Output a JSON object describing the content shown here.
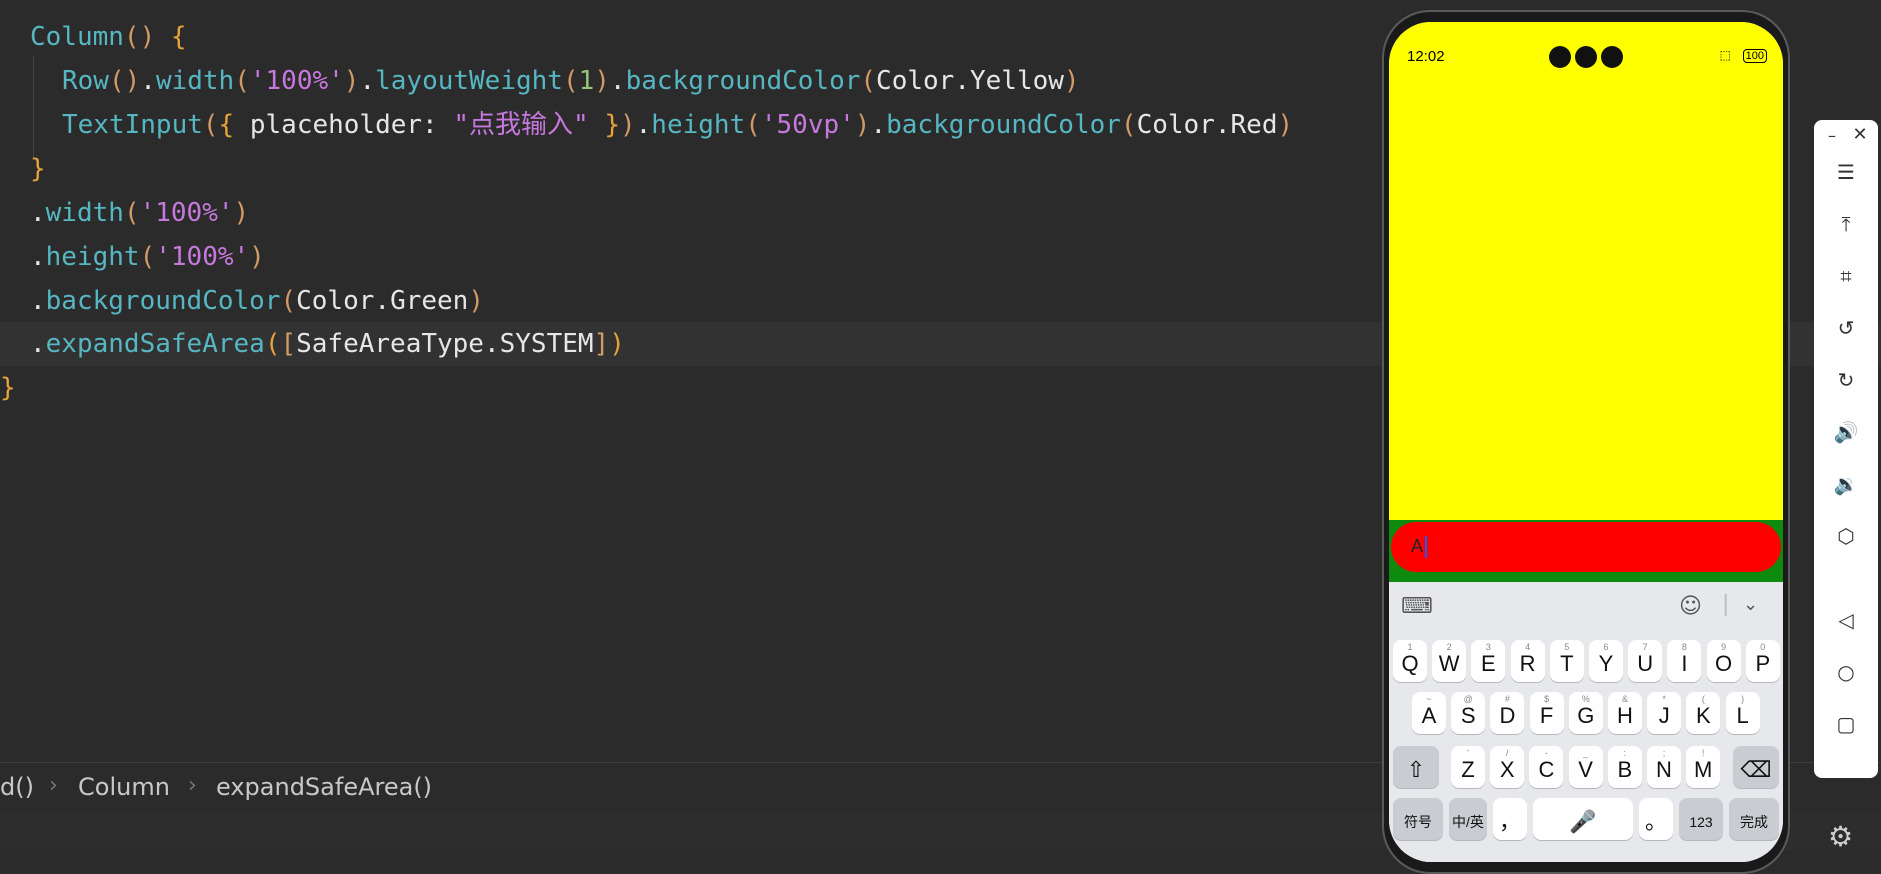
{
  "editor": {
    "lines": [
      {
        "indent": 1,
        "tokens": [
          [
            "fn",
            "Column"
          ],
          [
            "paren",
            "() "
          ],
          [
            "brace",
            "{"
          ]
        ]
      },
      {
        "indent": 2,
        "tokens": [
          [
            "fn",
            "Row"
          ],
          [
            "paren",
            "()"
          ],
          [
            "dot",
            "."
          ],
          [
            "fn",
            "width"
          ],
          [
            "paren",
            "("
          ],
          [
            "str",
            "'100%'"
          ],
          [
            "paren",
            ")"
          ],
          [
            "dot",
            "."
          ],
          [
            "fn",
            "layoutWeight"
          ],
          [
            "paren",
            "("
          ],
          [
            "num",
            "1"
          ],
          [
            "paren",
            ")"
          ],
          [
            "dot",
            "."
          ],
          [
            "fn",
            "backgroundColor"
          ],
          [
            "paren",
            "("
          ],
          [
            "plain",
            "Color"
          ],
          [
            "dot",
            "."
          ],
          [
            "plain",
            "Yellow"
          ],
          [
            "paren",
            ")"
          ]
        ]
      },
      {
        "indent": 2,
        "tokens": [
          [
            "fn",
            "TextInput"
          ],
          [
            "paren",
            "("
          ],
          [
            "brace",
            "{ "
          ],
          [
            "plain",
            "placeholder: "
          ],
          [
            "str",
            "\"点我输入\""
          ],
          [
            "brace",
            " }"
          ],
          [
            "paren",
            ")"
          ],
          [
            "dot",
            "."
          ],
          [
            "fn",
            "height"
          ],
          [
            "paren",
            "("
          ],
          [
            "str",
            "'50vp'"
          ],
          [
            "paren",
            ")"
          ],
          [
            "dot",
            "."
          ],
          [
            "fn",
            "backgroundColor"
          ],
          [
            "paren",
            "("
          ],
          [
            "plain",
            "Color"
          ],
          [
            "dot",
            "."
          ],
          [
            "plain",
            "Red"
          ],
          [
            "paren",
            ")"
          ]
        ]
      },
      {
        "indent": 1,
        "tokens": [
          [
            "brace",
            "}"
          ]
        ]
      },
      {
        "indent": 1,
        "tokens": [
          [
            "dot",
            "."
          ],
          [
            "fn",
            "width"
          ],
          [
            "paren",
            "("
          ],
          [
            "str",
            "'100%'"
          ],
          [
            "paren",
            ")"
          ]
        ]
      },
      {
        "indent": 1,
        "tokens": [
          [
            "dot",
            "."
          ],
          [
            "fn",
            "height"
          ],
          [
            "paren",
            "("
          ],
          [
            "str",
            "'100%'"
          ],
          [
            "paren",
            ")"
          ]
        ]
      },
      {
        "indent": 1,
        "tokens": [
          [
            "dot",
            "."
          ],
          [
            "fn",
            "backgroundColor"
          ],
          [
            "paren",
            "("
          ],
          [
            "plain",
            "Color"
          ],
          [
            "dot",
            "."
          ],
          [
            "plain",
            "Green"
          ],
          [
            "paren",
            ")"
          ]
        ]
      },
      {
        "indent": 1,
        "tokens": [
          [
            "dot",
            "."
          ],
          [
            "fn",
            "expandSafeArea"
          ],
          [
            "brace",
            "("
          ],
          [
            "paren",
            "["
          ],
          [
            "plain",
            "SafeAreaType"
          ],
          [
            "dot",
            "."
          ],
          [
            "plain",
            "SYSTEM"
          ],
          [
            "paren",
            "]"
          ],
          [
            "brace",
            ")"
          ]
        ]
      },
      {
        "indent": 0,
        "tokens": [
          [
            "brace",
            "}"
          ]
        ]
      }
    ]
  },
  "breadcrumb": {
    "items": [
      "d()",
      "Column",
      "expandSafeArea()"
    ],
    "separator": "›"
  },
  "phone": {
    "time": "12:02",
    "battery": "100",
    "input_value": "A",
    "keyboard": {
      "row1": [
        [
          "1",
          "Q"
        ],
        [
          "2",
          "W"
        ],
        [
          "3",
          "E"
        ],
        [
          "4",
          "R"
        ],
        [
          "5",
          "T"
        ],
        [
          "6",
          "Y"
        ],
        [
          "7",
          "U"
        ],
        [
          "8",
          "I"
        ],
        [
          "9",
          "O"
        ],
        [
          "0",
          "P"
        ]
      ],
      "row2": [
        [
          "~",
          "A"
        ],
        [
          "@",
          "S"
        ],
        [
          "#",
          "D"
        ],
        [
          "$",
          "F"
        ],
        [
          "%",
          "G"
        ],
        [
          "&",
          "H"
        ],
        [
          "*",
          "J"
        ],
        [
          "(",
          "K"
        ],
        [
          ")",
          "L"
        ]
      ],
      "row3": [
        [
          "'",
          "Z"
        ],
        [
          "/",
          "X"
        ],
        [
          "-",
          "C"
        ],
        [
          "_",
          "V"
        ],
        [
          ":",
          "B"
        ],
        [
          ";",
          "N"
        ],
        [
          "!",
          "M"
        ]
      ],
      "symbols_label": "符号",
      "lang_label": "中/英",
      "comma_label": "，",
      "period_label": "。",
      "numbers_label": "123",
      "done_label": "完成"
    }
  },
  "colors": {
    "phone_yellow": "#ffff00",
    "input_red": "#ff0000",
    "safe_green": "#0e8a0e"
  }
}
